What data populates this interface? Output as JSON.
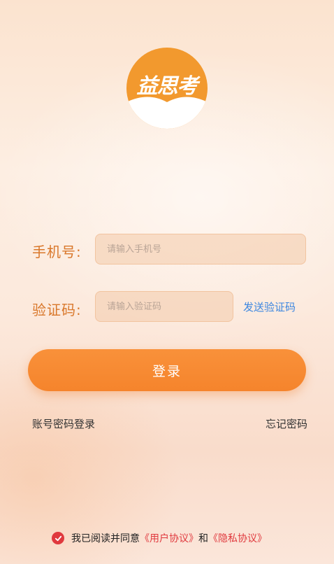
{
  "logo": {
    "text": "益思考"
  },
  "form": {
    "phone_label": "手机号:",
    "phone_placeholder": "请输入手机号",
    "phone_value": "",
    "code_label": "验证码:",
    "code_placeholder": "请输入验证码",
    "code_value": "",
    "send_code_label": "发送验证码",
    "login_label": "登录"
  },
  "links": {
    "password_login": "账号密码登录",
    "forgot_password": "忘记密码"
  },
  "agreement": {
    "checked": true,
    "prefix": "我已阅读并同意",
    "user_agreement": "《用户协议》",
    "conjunction": "和",
    "privacy_agreement": "《隐私协议》"
  },
  "colors": {
    "accent": "#f5842c",
    "label": "#d9772a",
    "link_blue": "#3d87e0",
    "agreement_red": "#e0393e"
  },
  "icons": {
    "checkbox": "check-circle-icon"
  }
}
